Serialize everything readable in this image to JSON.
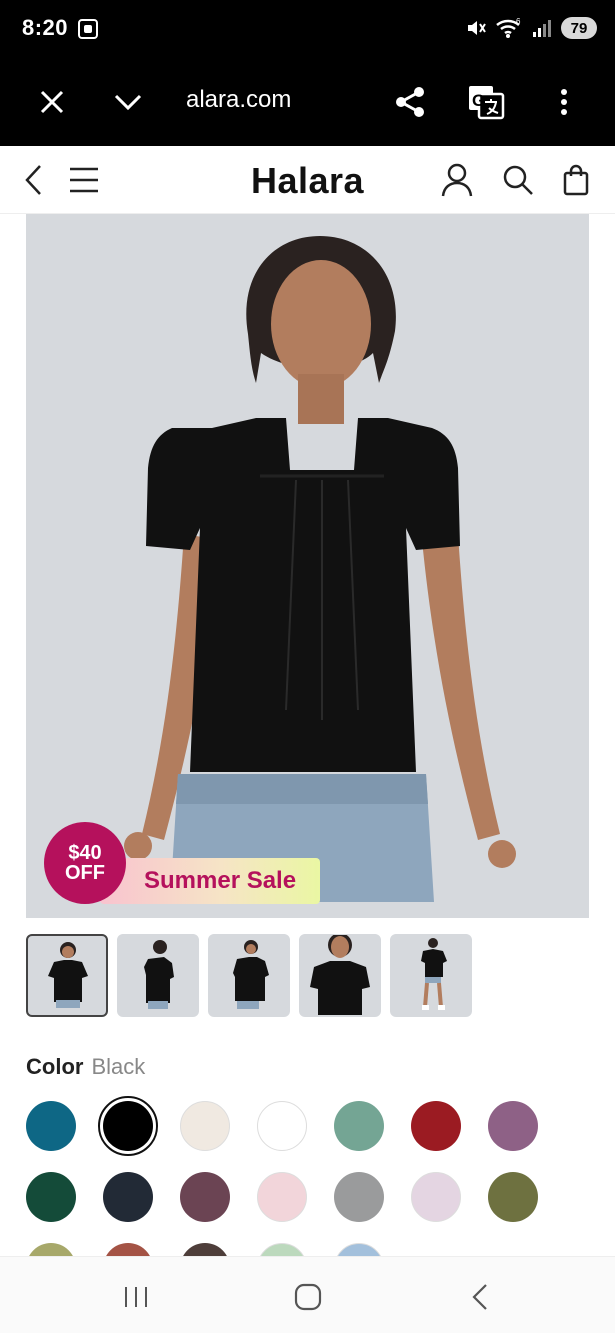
{
  "status": {
    "time": "8:20",
    "battery": "79",
    "network": "6"
  },
  "browser": {
    "url": "alara.com"
  },
  "site": {
    "logo": "Halara"
  },
  "promo": {
    "amount": "$40",
    "off": "OFF",
    "banner": "Summer Sale"
  },
  "product": {
    "color_label": "Color",
    "color_value": "Black",
    "thumbnails": [
      "front-view",
      "side-view",
      "three-quarter-view",
      "close-up-view",
      "full-body-view"
    ],
    "swatches": [
      {
        "color": "#0e6785",
        "light": false,
        "selected": false
      },
      {
        "color": "#000000",
        "light": false,
        "selected": true
      },
      {
        "color": "#f0e9e1",
        "light": true,
        "selected": false
      },
      {
        "color": "#ffffff",
        "light": true,
        "selected": false
      },
      {
        "color": "#74a594",
        "light": false,
        "selected": false
      },
      {
        "color": "#9b1b22",
        "light": false,
        "selected": false
      },
      {
        "color": "#8e6186",
        "light": false,
        "selected": false
      },
      {
        "color": "#144b39",
        "light": false,
        "selected": false
      },
      {
        "color": "#222a36",
        "light": false,
        "selected": false
      },
      {
        "color": "#6b4453",
        "light": false,
        "selected": false
      },
      {
        "color": "#f2d5da",
        "light": true,
        "selected": false
      },
      {
        "color": "#9a9b9c",
        "light": false,
        "selected": false
      },
      {
        "color": "#e4d5e2",
        "light": true,
        "selected": false
      },
      {
        "color": "#6e7140",
        "light": false,
        "selected": false
      },
      {
        "color": "#a7a86a",
        "light": false,
        "selected": false
      },
      {
        "color": "#a45345",
        "light": false,
        "selected": false
      },
      {
        "color": "#4e3e3a",
        "light": false,
        "selected": false
      },
      {
        "color": "#bcd9bd",
        "light": true,
        "selected": false
      },
      {
        "color": "#a3c0dc",
        "light": true,
        "selected": false
      }
    ]
  },
  "colors": {
    "accent": "#b5115c",
    "toolbar": "#000000",
    "image_bg": "#d6d9dd"
  }
}
